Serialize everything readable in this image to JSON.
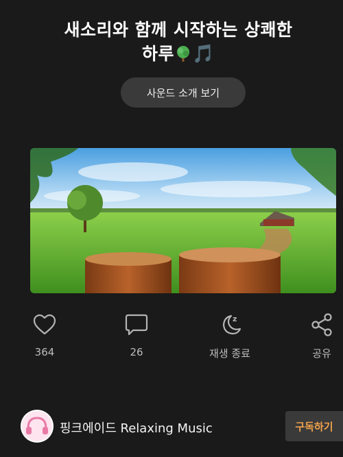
{
  "post": {
    "title_line1": "새소리와 함께 시작하는 상쾌한",
    "title_line2": "하루",
    "title_note": "🎵"
  },
  "intro_button": {
    "label": "사운드 소개 보기"
  },
  "actions": {
    "like": {
      "icon": "heart-icon",
      "label": "364"
    },
    "comment": {
      "icon": "comment-icon",
      "label": "26"
    },
    "sleep": {
      "icon": "moon-sleep-icon",
      "label": "재생 종료"
    },
    "share": {
      "icon": "share-icon",
      "label": "공유"
    }
  },
  "channel": {
    "name": "핑크에이드 Relaxing Music",
    "subscribe_label": "구독하기",
    "accent": "#f0a04b"
  },
  "colors": {
    "background": "#1a1a1a",
    "button_bg": "#3a3a3a"
  }
}
